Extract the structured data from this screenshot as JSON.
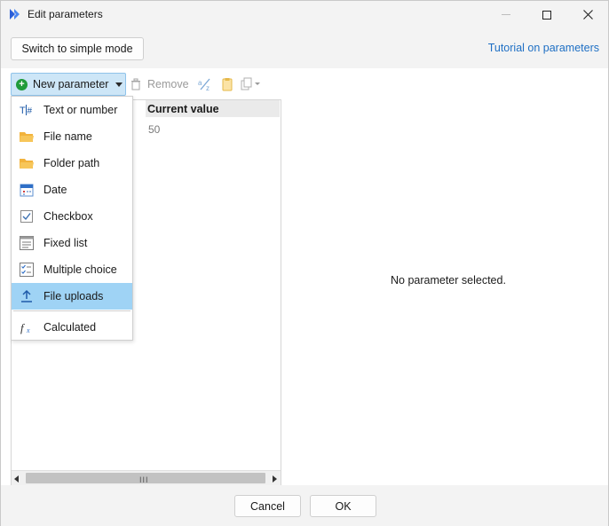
{
  "window": {
    "title": "Edit parameters"
  },
  "topbar": {
    "simple_mode_label": "Switch to simple mode",
    "tutorial_label": "Tutorial on parameters"
  },
  "toolbar": {
    "new_parameter_label": "New parameter",
    "remove_label": "Remove"
  },
  "table": {
    "column_header": "Current value",
    "rows": [
      {
        "value": "50"
      }
    ]
  },
  "detail": {
    "empty_message": "No parameter selected."
  },
  "menu": {
    "items": [
      {
        "label": "Text or number",
        "icon": "text-number-icon"
      },
      {
        "label": "File name",
        "icon": "folder-icon"
      },
      {
        "label": "Folder path",
        "icon": "folder-icon"
      },
      {
        "label": "Date",
        "icon": "calendar-icon"
      },
      {
        "label": "Checkbox",
        "icon": "checkbox-icon"
      },
      {
        "label": "Fixed list",
        "icon": "list-icon"
      },
      {
        "label": "Multiple choice",
        "icon": "multiple-choice-icon"
      },
      {
        "label": "File uploads",
        "icon": "upload-icon",
        "selected": true
      },
      {
        "label": "Calculated",
        "icon": "function-icon"
      }
    ]
  },
  "footer": {
    "cancel_label": "Cancel",
    "ok_label": "OK"
  },
  "colors": {
    "accent": "#1e6fc4",
    "selection": "#9fd3f5",
    "new_button_bg": "#cde6f7",
    "add_green": "#1f9b3a",
    "folder_orange": "#f2b33d"
  }
}
